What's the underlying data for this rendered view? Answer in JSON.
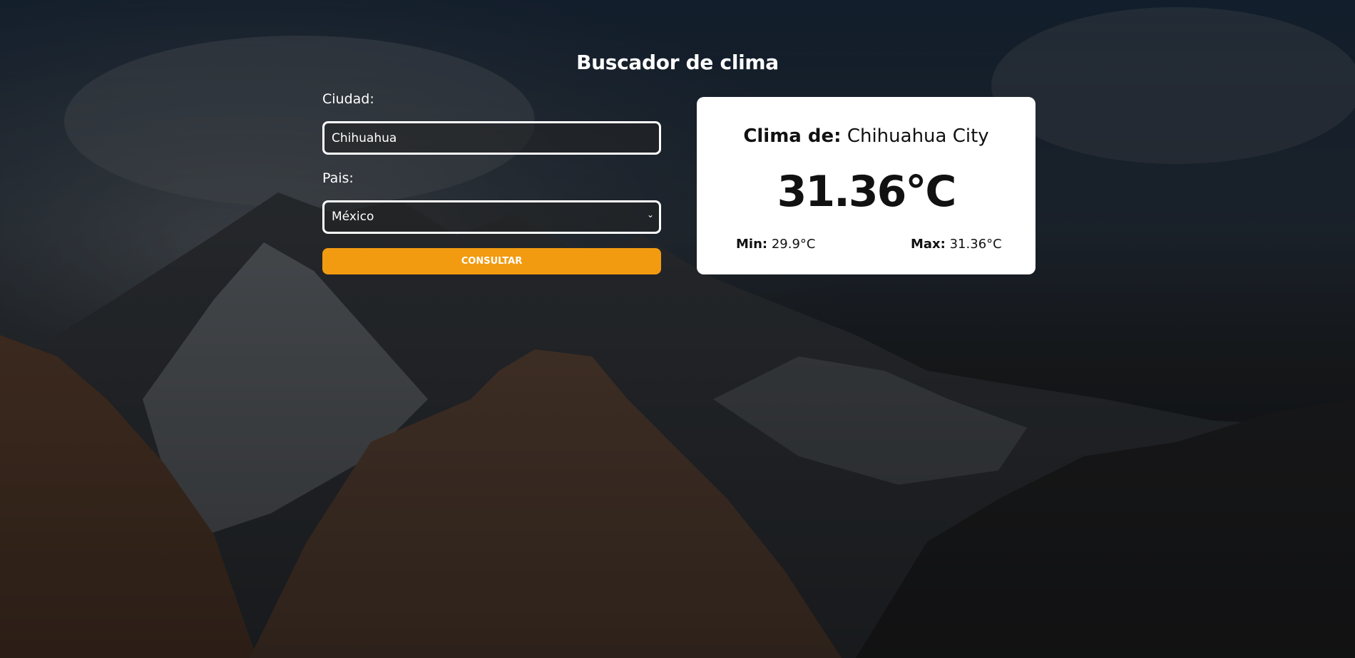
{
  "header": {
    "title": "Buscador de clima"
  },
  "form": {
    "city_label": "Ciudad:",
    "city_value": "Chihuahua",
    "country_label": "Pais:",
    "country_selected": "México",
    "submit_label": "CONSULTAR"
  },
  "result": {
    "heading_prefix": "Clima de:",
    "city_name": "Chihuahua City",
    "temperature": "31.36°C",
    "min_label": "Min:",
    "min_value": "29.9°C",
    "max_label": "Max:",
    "max_value": "31.36°C"
  },
  "colors": {
    "accent": "#f29b11",
    "card_background": "#ffffff",
    "text_light": "#ffffff"
  },
  "icons": {
    "select": "chevron-down-icon"
  }
}
